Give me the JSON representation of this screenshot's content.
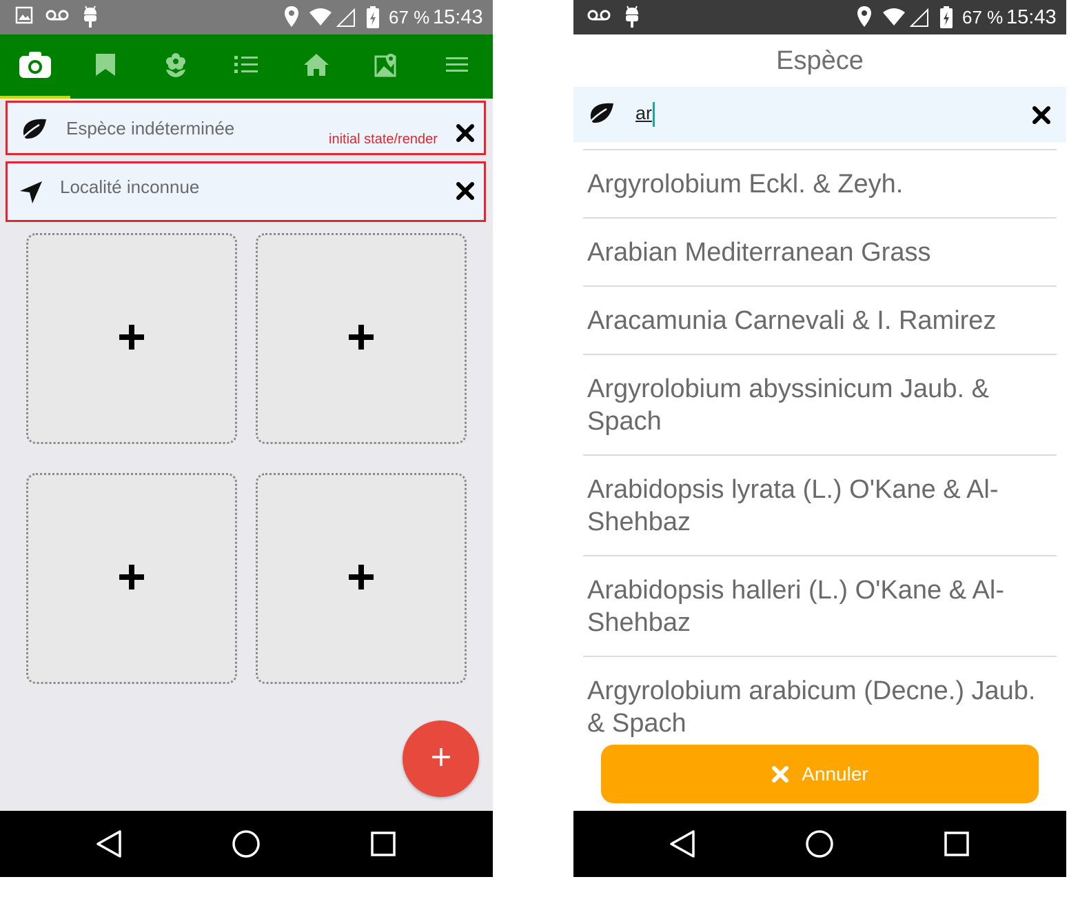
{
  "left_screen": {
    "status_bar": {
      "battery": "67 %",
      "time": "15:43"
    },
    "species_field": {
      "text": "Espèce indéterminée",
      "icon": "leaf-icon",
      "clear_icon": "close-icon"
    },
    "annotation": "initial state/render",
    "location_field": {
      "text": "Localité inconnue",
      "icon": "navigation-arrow-icon",
      "clear_icon": "close-icon"
    },
    "photo_slots": [
      {
        "icon": "plus-icon"
      },
      {
        "icon": "plus-icon"
      },
      {
        "icon": "plus-icon"
      },
      {
        "icon": "plus-icon"
      }
    ],
    "nav_icons": [
      "camera-icon",
      "bookmark-icon",
      "flower-icon",
      "list-icon",
      "home-icon",
      "map-icon",
      "menu-icon"
    ],
    "colors": {
      "appbar": "#008000",
      "fab": "#e74a3c",
      "highlight": "#e0262e"
    }
  },
  "right_screen": {
    "status_bar": {
      "battery": "67 %",
      "time": "15:43"
    },
    "title": "Espèce",
    "search": {
      "value": "ar"
    },
    "results": [
      "Argyrolobium Eckl. & Zeyh.",
      "Arabian Mediterranean Grass",
      "Aracamunia Carnevali & I. Ramirez",
      "Argyrolobium abyssinicum Jaub. & Spach",
      "Arabidopsis lyrata (L.) O'Kane & Al-Shehbaz",
      "Arabidopsis halleri (L.) O'Kane & Al-Shehbaz",
      "Argyrolobium arabicum (Decne.) Jaub. & Spach"
    ],
    "cancel_label": "Annuler",
    "colors": {
      "cancel_button": "#ffa500"
    }
  }
}
